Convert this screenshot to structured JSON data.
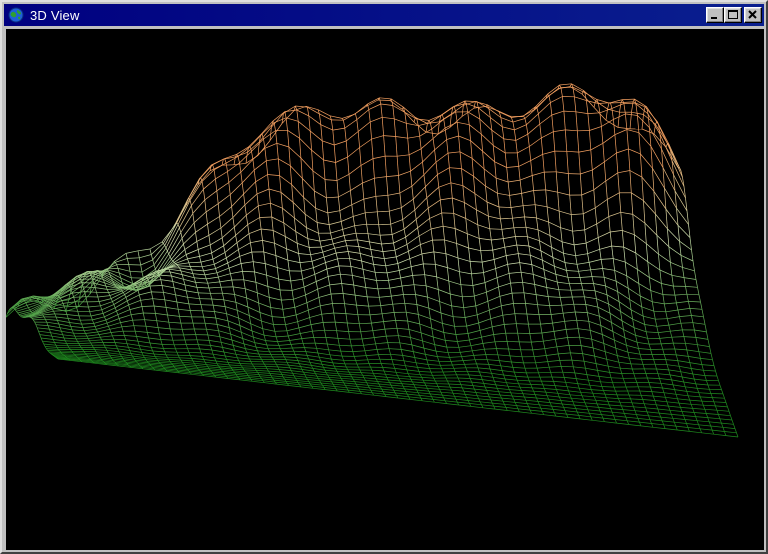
{
  "window": {
    "title": "3D View",
    "icon": "globe-icon",
    "buttons": [
      "minimize-icon",
      "maximize-icon",
      "close-icon"
    ]
  },
  "view": {
    "background": "#000000",
    "mesh_low_color": "#1f8a1f",
    "mesh_mid_color": "#cfe0b0",
    "mesh_high_color": "#f4a060"
  }
}
